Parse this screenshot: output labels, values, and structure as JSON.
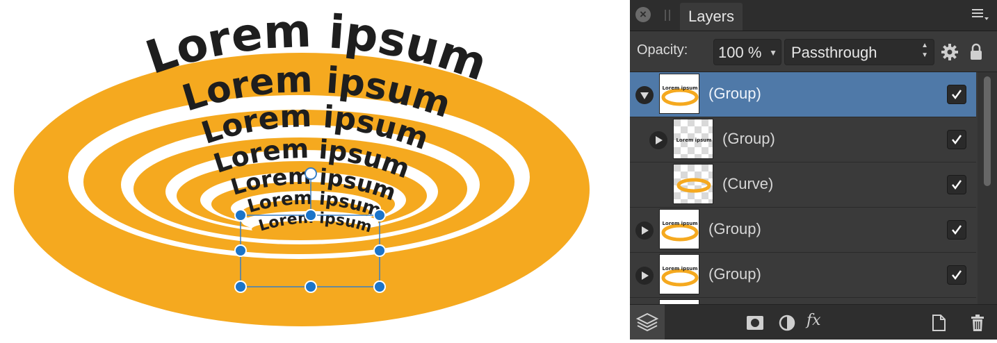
{
  "canvas": {
    "text_lines": [
      "Lorem ipsum",
      "Lorem ipsum",
      "Lorem ipsum",
      "Lorem ipsum",
      "Lorem ipsum",
      "Lorem ipsum",
      "Lorem ipsum"
    ],
    "ring_color": "#f5a91f",
    "selection_color": "#1b74c9"
  },
  "panel": {
    "tab_title": "Layers",
    "close_icon": "close-icon",
    "menu_icon": "panel-menu-icon",
    "opacity_label": "Opacity:",
    "opacity_value": "100 %",
    "blend_mode": "Passthrough",
    "layers": [
      {
        "name": "(Group)",
        "selected": true,
        "expanded": true,
        "indent": 0,
        "visible": true,
        "thumb_text": "Lorem ipsum"
      },
      {
        "name": "(Group)",
        "selected": false,
        "expanded": false,
        "indent": 1,
        "visible": true,
        "thumb_text": "Lorem ipsum"
      },
      {
        "name": "(Curve)",
        "selected": false,
        "expanded": null,
        "indent": 1,
        "visible": true,
        "thumb_text": ""
      },
      {
        "name": "(Group)",
        "selected": false,
        "expanded": false,
        "indent": 0,
        "visible": true,
        "thumb_text": "Lorem ipsum"
      },
      {
        "name": "(Group)",
        "selected": false,
        "expanded": false,
        "indent": 0,
        "visible": true,
        "thumb_text": "Lorem ipsum"
      }
    ],
    "bottom_icons": [
      "layers-stack-icon",
      "mask-icon",
      "adjustment-icon",
      "fx-icon",
      "new-document-icon",
      "trash-icon"
    ],
    "fx_label": "fx",
    "accent_selected": "#4f79a8"
  }
}
